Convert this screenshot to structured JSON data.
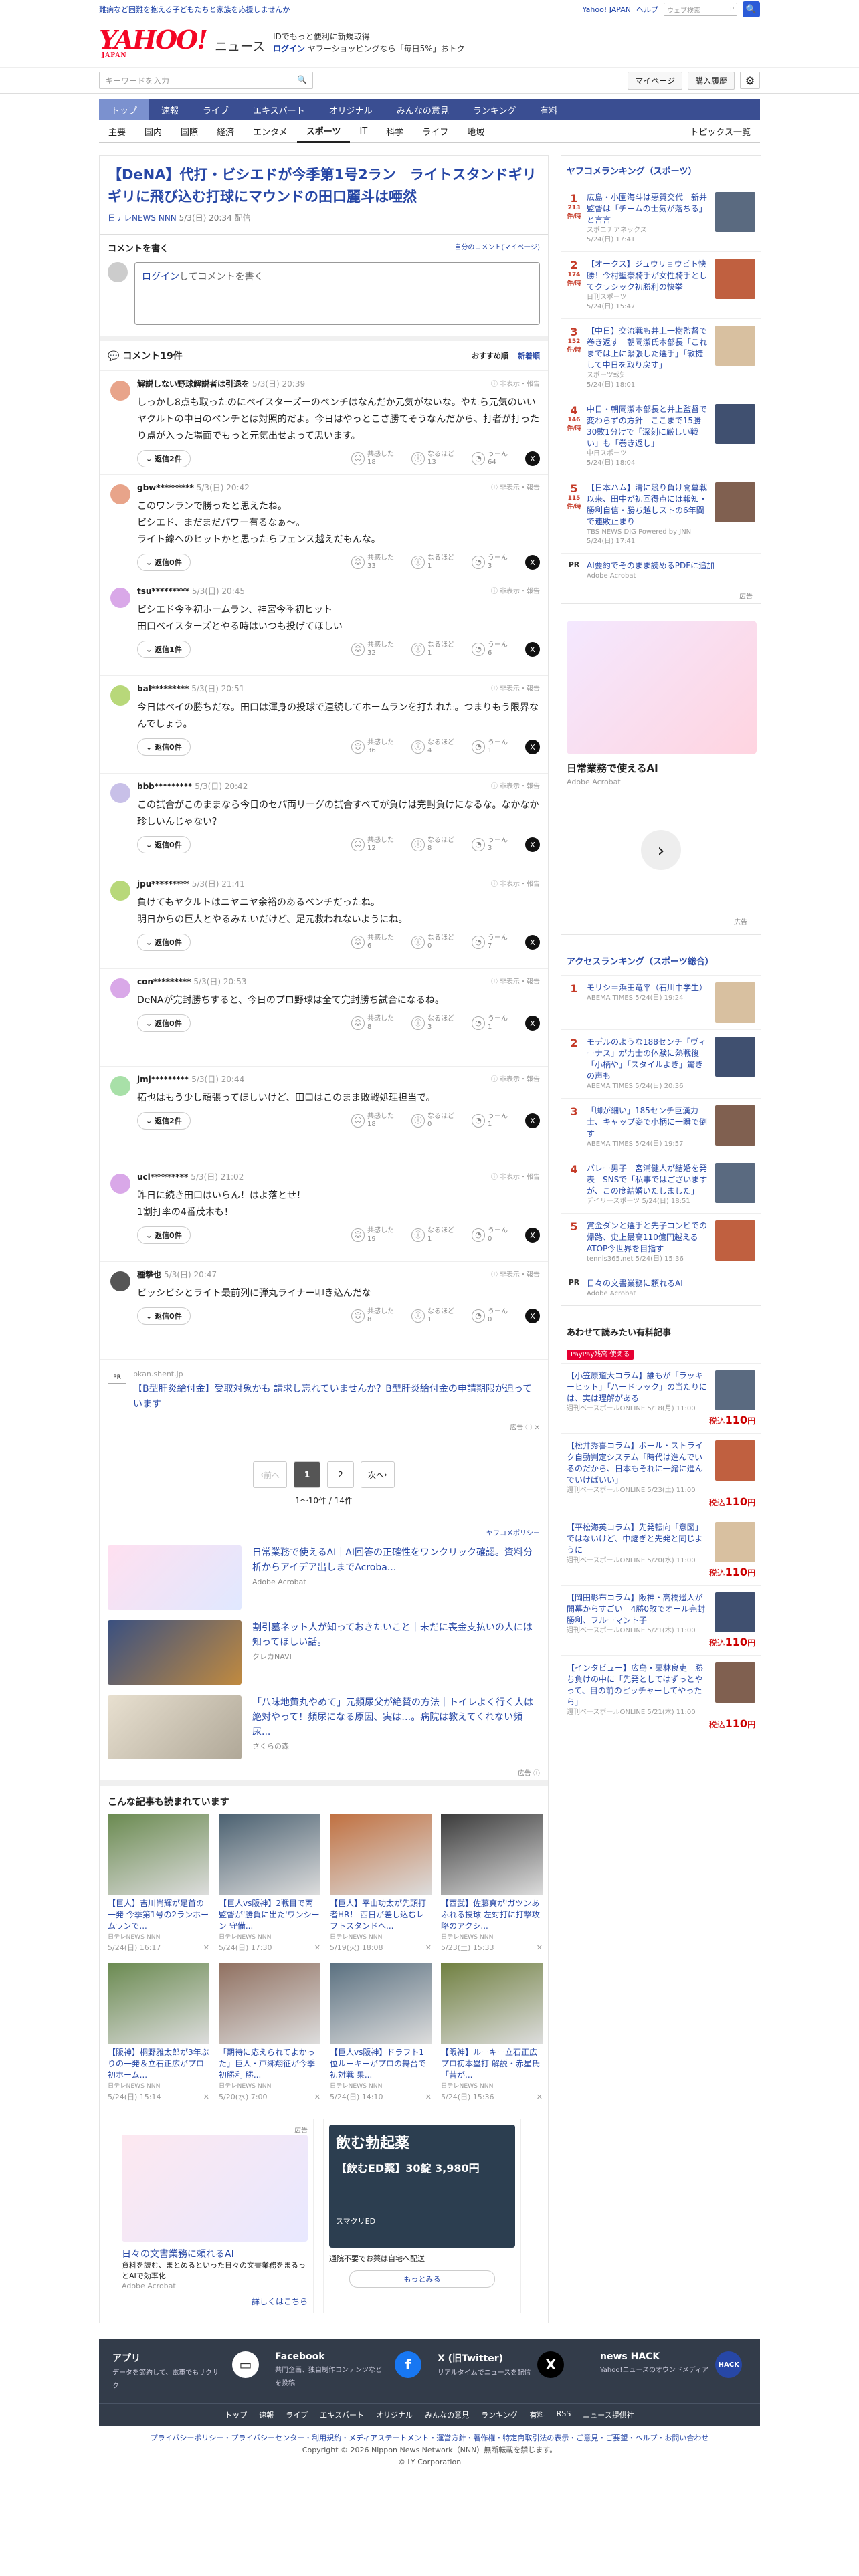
{
  "topbar": {
    "promo": "難病など困難を抱える子どもたちと家族を応援しませんか",
    "links": [
      "Yahoo! JAPAN",
      "ヘルプ"
    ],
    "search_placeholder": "ウェブ検索",
    "search_btn": "🔍"
  },
  "header": {
    "logo": "YAHOO!",
    "logo_sub": "JAPAN",
    "news": "ニュース",
    "line1": "IDでもっと便利に新規取得",
    "line1_b": "新規取得",
    "line2": "ログイン",
    "line2_rest": "ヤフーショッピングなら「毎日5%」おトク"
  },
  "searchrow": {
    "placeholder": "キーワードを入力",
    "mypage": "マイページ",
    "buy": "購入履歴"
  },
  "nav1": [
    "トップ",
    "速報",
    "ライブ",
    "エキスパート",
    "オリジナル",
    "みんなの意見",
    "ランキング",
    "有料"
  ],
  "nav2": [
    "主要",
    "国内",
    "国際",
    "経済",
    "エンタメ",
    "スポーツ",
    "IT",
    "科学",
    "ライフ",
    "地域"
  ],
  "nav2_right": "トピックス一覧",
  "article": {
    "title": "【DeNA】代打・ビシエドが今季第1号2ラン　ライトスタンドギリギリに飛び込む打球にマウンドの田口麗斗は唖然",
    "source": "日テレNEWS NNN",
    "date": "5/3(日) 20:34 配信"
  },
  "write": {
    "title": "コメントを書く",
    "mycomment": "自分のコメント(マイページ)",
    "login": "ログイン",
    "placeholder": "してコメントを書く"
  },
  "comments_head": {
    "label": "コメント19件",
    "sort1": "おすすめ順",
    "sort2": "新着順"
  },
  "react_labels": [
    "共感した",
    "なるほど",
    "うーん"
  ],
  "report": "非表示・報告",
  "comments": [
    {
      "name": "解説しない野球解説者は引退を",
      "date": "5/3(日) 20:39",
      "text": "しっかし8点も取ったのにベイスターズーのベンチはなんだか元気がないな。やたら元気のいいヤクルトの中日のベンチとは対照的だよ。今日はやっとこさ勝てそうなんだから、打者が打ったり点が入った場面でもっと元気出せよって思います。",
      "reply": "返信2件",
      "r": [
        "18",
        "13",
        "64"
      ],
      "color": "#e8a48a"
    },
    {
      "name": "gbw*********",
      "date": "5/3(日) 20:42",
      "text": "このワンランで勝ったと思えたね。\nビシエド、まだまだパワー有るなぁ〜。\nライト線へのヒットかと思ったらフェンス越えだもんな。",
      "reply": "返信0件",
      "r": [
        "33",
        "1",
        "3"
      ],
      "color": "#e8a48a"
    },
    {
      "name": "tsu*********",
      "date": "5/3(日) 20:45",
      "text": "ビシエド今季初ホームラン、神宮今季初ヒット\n田口ベイスターズとやる時はいつも投げてほしい",
      "reply": "返信1件",
      "r": [
        "32",
        "1",
        "6"
      ],
      "color": "#d9a8e8"
    },
    {
      "name": "bal*********",
      "date": "5/3(日) 20:51",
      "text": "今日はベイの勝ちだな。田口は渾身の投球で連続してホームランを打たれた。つまりもう限界なんでしょう。",
      "reply": "返信0件",
      "r": [
        "36",
        "4",
        "1"
      ],
      "color": "#b8d87a"
    },
    {
      "name": "bbb*********",
      "date": "5/3(日) 20:42",
      "text": "この試合がこのままなら今日のセパ両リーグの試合すべてが負けは完封負けになるな。なかなか珍しいんじゃない？",
      "reply": "返信0件",
      "r": [
        "12",
        "8",
        "3"
      ],
      "color": "#c8c0e8"
    },
    {
      "name": "jpu*********",
      "date": "5/3(日) 21:41",
      "text": "負けてもヤクルトはニヤニヤ余裕のあるベンチだったね。\n明日からの巨人とやるみたいだけど、足元救われないようにね。",
      "reply": "返信0件",
      "r": [
        "6",
        "0",
        "7"
      ],
      "color": "#b8d87a"
    },
    {
      "name": "con*********",
      "date": "5/3(日) 20:53",
      "text": "DeNAが完封勝ちすると、今日のプロ野球は全て完封勝ち試合になるね。",
      "reply": "返信0件",
      "r": [
        "8",
        "3",
        "1"
      ],
      "color": "#d9a8e8"
    },
    {
      "name": "jmj*********",
      "date": "5/3(日) 20:44",
      "text": "拓也はもう少し頑張ってほしいけど、田口はこのまま敗戦処理担当で。",
      "reply": "返信2件",
      "r": [
        "18",
        "0",
        "1"
      ],
      "color": "#a8e0a8"
    },
    {
      "name": "ucl*********",
      "date": "5/3(日) 21:02",
      "text": "昨日に続き田口はいらん！はよ落とせ！\n1割打率の4番茂木も！",
      "reply": "返信0件",
      "r": [
        "19",
        "1",
        "0"
      ],
      "color": "#d9a8e8"
    },
    {
      "name": "種撃也",
      "date": "5/3(日) 20:47",
      "text": "ビッシビシとライト最前列に弾丸ライナー叩き込んだな",
      "reply": "返信0件",
      "r": [
        "8",
        "1",
        "0"
      ],
      "color": "#555"
    }
  ],
  "pr_ad": {
    "label": "PR",
    "src": "bkan.shent.jp",
    "text": "【B型肝炎給付金】受取対象かも 請求し忘れていませんか？B型肝炎給付金の申請期限が迫っています"
  },
  "ad_label": "広告",
  "pager": {
    "prev": "前へ",
    "p1": "1",
    "p2": "2",
    "next": "次へ",
    "count": "1〜10件 / 14件"
  },
  "policy": "ヤフコメポリシー",
  "ads": [
    {
      "title": "日常業務で使えるAI｜AI回答の正確性をワンクリック確認。資料分析からアイデア出しまでAcroba...",
      "src": "Adobe Acrobat"
    },
    {
      "title": "割引墓ネット人が知っておきたいこと｜未だに喪金支払いの人には知ってほしい話。",
      "src": "クレカNAVI"
    },
    {
      "title": "「八味地黄丸やめて」元頻尿父が絶賛の方法｜トイレよく行く人は絶対やって！頻尿になる原因、実は…。病院は教えてくれない頻尿...",
      "src": "さくらの森"
    }
  ],
  "related": {
    "title": "こんな記事も読まれています",
    "items": [
      {
        "t": "【巨人】吉川尚輝が足首の一発 今季第1号の2ランホームランで...",
        "s": "日テレNEWS NNN",
        "d": "5/24(日) 16:17",
        "c": "#6a8a50"
      },
      {
        "t": "【巨人vs阪神】2戦目で両監督が'勝負に出た'ワンシーン 守備...",
        "s": "日テレNEWS NNN",
        "d": "5/24(日) 17:30",
        "c": "#4a6070"
      },
      {
        "t": "【巨人】平山功太が先頭打者HR！ 西日が差し込むレフトスタンドへ...",
        "s": "日テレNEWS NNN",
        "d": "5/19(火) 18:08",
        "c": "#c07040"
      },
      {
        "t": "【西武】佐藤爽が'ガツンあふれる投球 左対打に打撃攻略のアクシ...",
        "s": "日テレNEWS NNN",
        "d": "5/23(土) 15:33",
        "c": "#3a3a3a"
      },
      {
        "t": "【阪神】桐野雅太郎が3年ぶりの一発＆立石正広がプロ初ホーム...",
        "s": "日テレNEWS NNN",
        "d": "5/24(日) 15:14",
        "c": "#6a8a50"
      },
      {
        "t": "「期待に応えられてよかった」巨人・戸郷翔征が今季初勝利 勝...",
        "s": "日テレNEWS NNN",
        "d": "5/20(水) 7:00",
        "c": "#907060"
      },
      {
        "t": "【巨人vs阪神】ドラフト1位ルーキーがプロの舞台で初対戦 果...",
        "s": "日テレNEWS NNN",
        "d": "5/24(日) 14:10",
        "c": "#5a7080"
      },
      {
        "t": "【阪神】ルーキー立石正広プロ初本塁打 解説・赤星氏「昔が...",
        "s": "日テレNEWS NNN",
        "d": "5/24(日) 15:36",
        "c": "#708040"
      }
    ]
  },
  "bottom_ads": [
    {
      "title": "日々の文書業務に頼れるAI",
      "desc": "資料を読む、まとめるといった日々の文書業務をまるっとAIで効率化",
      "src": "Adobe Acrobat",
      "btn": "詳しくはこちら"
    },
    {
      "title": "飲む勃起薬",
      "sub": "【飲むED薬】30錠 3,980円",
      "desc": "通院不要でお薬は自宅へ配送",
      "src": "スマクリED",
      "btn": "もっとみる"
    }
  ],
  "side_rank1": {
    "title": "ヤフコメランキング（スポーツ）",
    "items": [
      {
        "n": "1",
        "c": "213",
        "t": "広島・小園海斗は悪質交代　新井監督は「チームの士気が落ちる」と言言",
        "s": "スポニチアネックス",
        "d": "5/24(日) 17:41"
      },
      {
        "n": "2",
        "c": "174",
        "t": "【オークス】ジュウリョウビト快勝！今村聖奈騎手が女性騎手としてクラシック初勝利の快挙",
        "s": "日刊スポーツ",
        "d": "5/24(日) 15:47"
      },
      {
        "n": "3",
        "c": "152",
        "t": "【中日】交流戦も井上一樹監督で巻き返す　朝岡潔氏本部長「これまでは上に緊張した選手」「敏捷して中日を取り戻す」",
        "s": "スポーツ報知",
        "d": "5/24(日) 18:01"
      },
      {
        "n": "4",
        "c": "146",
        "t": "中日・朝岡潔本部長と井上監督で変わらずの方針　ここまで15勝30敗1分けで「深刻に厳しい戦い」も「巻き返し」",
        "s": "中日スポーツ",
        "d": "5/24(日) 18:04"
      },
      {
        "n": "5",
        "c": "115",
        "t": "【日本ハム】清に競り負け開幕戦以来、田中が初回得点には報知・勝利自信・勝ち越しストの6年間で連敗止まり",
        "s": "TBS NEWS DIG Powered by JNN",
        "d": "5/24(日) 17:41"
      }
    ]
  },
  "side_pr": {
    "label": "PR",
    "t": "AI要約でそのまま読めるPDFに追加",
    "s": "Adobe Acrobat"
  },
  "side_ad": {
    "title": "日常業務で使えるAI",
    "src": "Adobe Acrobat"
  },
  "side_rank2": {
    "title": "アクセスランキング（スポーツ総合）",
    "items": [
      {
        "n": "1",
        "t": "モリシ＝浜田竜平（石川中学生）",
        "s": "ABEMA TIMES",
        "d": "5/24(日) 19:24"
      },
      {
        "n": "2",
        "t": "モデルのような188センチ「ヴィーナス」が力士の体験に熱戦後「小柄や」「スタイルよき」驚きの声も",
        "s": "ABEMA TIMES",
        "d": "5/24(日) 20:36"
      },
      {
        "n": "3",
        "t": "「脚が細い」185センチ巨漢力士、キャップ姿で小柄に一瞬で倒す",
        "s": "ABEMA TIMES",
        "d": "5/24(日) 19:57"
      },
      {
        "n": "4",
        "t": "バレー男子　宮浦健人が結婚を発表　SNSで「私事ではございますが、この度結婚いたしました」",
        "s": "デイリースポーツ",
        "d": "5/24(日) 18:51"
      },
      {
        "n": "5",
        "t": "賞金ダンと選手と先子コンビでの帰路、史上最高110億円越えるATOP今世界を目指す",
        "s": "tennis365.net",
        "d": "5/24(日) 15:36"
      }
    ]
  },
  "side_pr2": {
    "label": "PR",
    "t": "日々の文書業務に頼れるAI",
    "s": "Adobe Acrobat"
  },
  "paid": {
    "title": "あわせて読みたい有料記事",
    "badge": "PayPay残高 使える",
    "items": [
      {
        "t": "【小笠原道大コラム】誰もが「ラッキーヒット」「ハードラック」の当たりには、実は理解がある",
        "s": "週刊ベースボールONLINE",
        "d": "5/18(月) 11:00",
        "p": "110"
      },
      {
        "t": "【松井秀喜コラム】ボール・ストライク自動判定システム「時代は進んでいるのだから、日本もそれに一緒に進んでいけばいい」",
        "s": "週刊ベースボールONLINE",
        "d": "5/23(土) 11:00",
        "p": "110"
      },
      {
        "t": "【平松海英コラム】先発転向「意図」ではないけど、中継ぎと先発と同じように",
        "s": "週刊ベースボールONLINE",
        "d": "5/20(水) 11:00",
        "p": "110"
      },
      {
        "t": "【岡田彰布コラム】阪神・高橋遥人が開幕からすごい　4勝0敗でオール完封勝利、フルーマント子",
        "s": "週刊ベースボールONLINE",
        "d": "5/21(木) 11:00",
        "p": "110"
      },
      {
        "t": "【インタビュー】広島・栗林良吏　勝ち負けの中に「先発としてはずっとやって、目の前のピッチャーしてやったら」",
        "s": "週刊ベースボールONLINE",
        "d": "5/21(木) 11:00",
        "p": "110"
      }
    ]
  },
  "price_label": "税込",
  "footer": {
    "cols": [
      {
        "t": "アプリ",
        "d": "データを節約して、電車でもサクサク"
      },
      {
        "t": "Facebook",
        "d": "共同企画、独自制作コンテンツなどを投稿"
      },
      {
        "t": "X (旧Twitter)",
        "d": "リアルタイムでニュースを配信"
      },
      {
        "t": "news HACK",
        "d": "Yahoo!ニュースのオウンドメディア"
      }
    ],
    "links": [
      "トップ",
      "速報",
      "ライブ",
      "エキスパート",
      "オリジナル",
      "みんなの意見",
      "ランキング",
      "有料",
      "RSS",
      "ニュース提供社"
    ]
  },
  "legal": {
    "links": "プライバシーポリシー・プライバシーセンター・利用規約・メディアステートメント・運営方針・著作権・特定商取引法の表示・ご意見・ご要望・ヘルプ・お問い合わせ",
    "copy": "Copyright © 2026 Nippon News Network（NNN）無断転載を禁じます。",
    "ly": "© LY Corporation"
  }
}
